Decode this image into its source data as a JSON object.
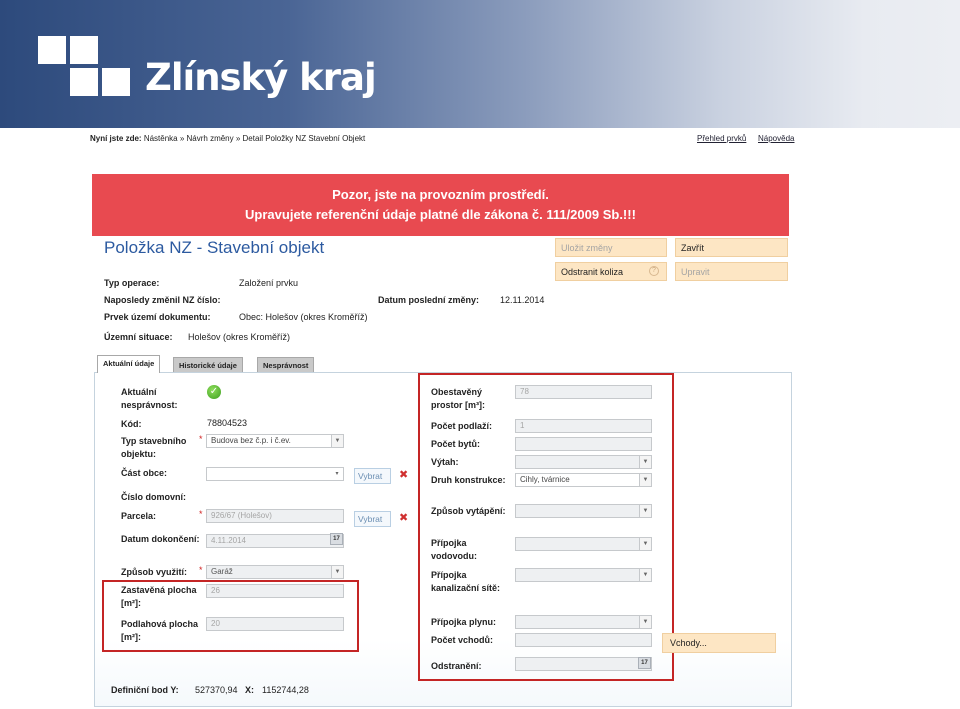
{
  "brand": {
    "name": "Zlínský kraj"
  },
  "breadcrumb": {
    "prefix": "Nyní jste zde:",
    "path": "Nástěnka » Návrh změny » Detail Položky NZ Stavební Objekt"
  },
  "toplinks": {
    "overview": "Přehled prvků",
    "help": "Nápověda"
  },
  "warning": {
    "line1": "Pozor, jste na provozním prostředí.",
    "line2": "Upravujete referenční údaje platné dle zákona č. 111/2009 Sb.!!!"
  },
  "title": "Položka NZ - Stavební objekt",
  "buttons": {
    "save": "Uložit změny",
    "close": "Zavřít",
    "remove_collision": "Odstranit koliza",
    "help_mark": "?",
    "edit": "Upravit"
  },
  "info": {
    "operation_type_label": "Typ operace:",
    "operation_type_value": "Založení prvku",
    "last_changed_label": "Naposledy změnil NZ číslo:",
    "last_change_date_label": "Datum poslední změny:",
    "last_change_date_value": "12.11.2014",
    "territory_element_label": "Prvek území dokumentu:",
    "territory_element_value": "Obec: Holešov (okres Kroměříž)",
    "territory_situation_label": "Územní situace:",
    "territory_situation_value": "Holešov (okres Kroměříž)"
  },
  "tabs": [
    "Aktuální údaje",
    "Historické údaje",
    "Nesprávnost"
  ],
  "left": {
    "incorrectness_label": "Aktuální nesprávnost:",
    "code_label": "Kód:",
    "code_value": "78804523",
    "building_type_label": "Typ stavebního objektu:",
    "building_type_value": "Budova bez č.p. i č.ev.",
    "municipality_part_label": "Část obce:",
    "house_number_label": "Číslo domovní:",
    "parcel_label": "Parcela:",
    "parcel_value": "926/67 (Holešov)",
    "completion_label": "Datum dokončení:",
    "completion_value": "4.11.2014",
    "usage_label": "Způsob využití:",
    "usage_value": "Garáž",
    "built_area_label": "Zastavěná plocha [m²]:",
    "built_area_value": "26",
    "floor_area_label": "Podlahová plocha [m²]:",
    "floor_area_value": "20",
    "select_button": "Vybrat",
    "calendar_badge": "17"
  },
  "right": {
    "volume_label": "Obestavěný prostor [m³]:",
    "volume_value": "78",
    "floors_label": "Počet podlaží:",
    "floors_value": "1",
    "flats_label": "Počet bytů:",
    "elevator_label": "Výtah:",
    "construction_label": "Druh konstrukce:",
    "construction_value": "Cihly, tvárnice",
    "heating_label": "Způsob vytápění:",
    "water_label": "Přípojka vodovodu:",
    "sewer_label": "Přípojka kanalizační sítě:",
    "gas_label": "Přípojka plynu:",
    "entrances_label": "Počet vchodů:",
    "removal_label": "Odstranění:",
    "entrances_button": "Vchody..."
  },
  "definition_point": {
    "label_y": "Definiční bod Y:",
    "y": "527370,94",
    "label_x": "X:",
    "x": "1152744,28"
  },
  "colors": {
    "warning": "#e84a50",
    "title": "#2c5aa0",
    "highlight_box": "#c42525",
    "button_bg": "#fde6c4"
  }
}
